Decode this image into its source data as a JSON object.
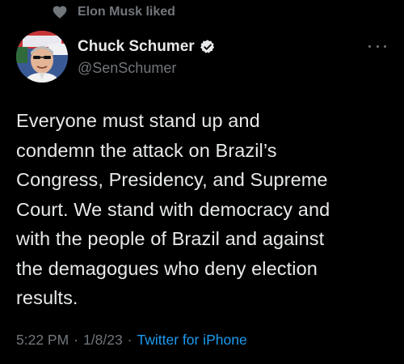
{
  "social_context": {
    "icon": "heart-icon",
    "text": "Elon Musk liked"
  },
  "author": {
    "name": "Chuck Schumer",
    "handle": "@SenSchumer",
    "verified_icon": "verified-badge-icon",
    "avatar_icon": "avatar"
  },
  "menu": {
    "icon": "more-options-icon"
  },
  "tweet": {
    "text": "Everyone must stand up and\ncondemn the attack on Brazil’s\nCongress, Presidency, and Supreme\nCourt. We stand with democracy and\nwith the people of Brazil and against\nthe demagogues who deny election\nresults.",
    "time": "5:22 PM",
    "date": "1/8/23",
    "source": "Twitter for iPhone"
  },
  "colors": {
    "background": "#000000",
    "text": "#e7e9ea",
    "muted": "#71767b",
    "link": "#1d9bf0"
  }
}
